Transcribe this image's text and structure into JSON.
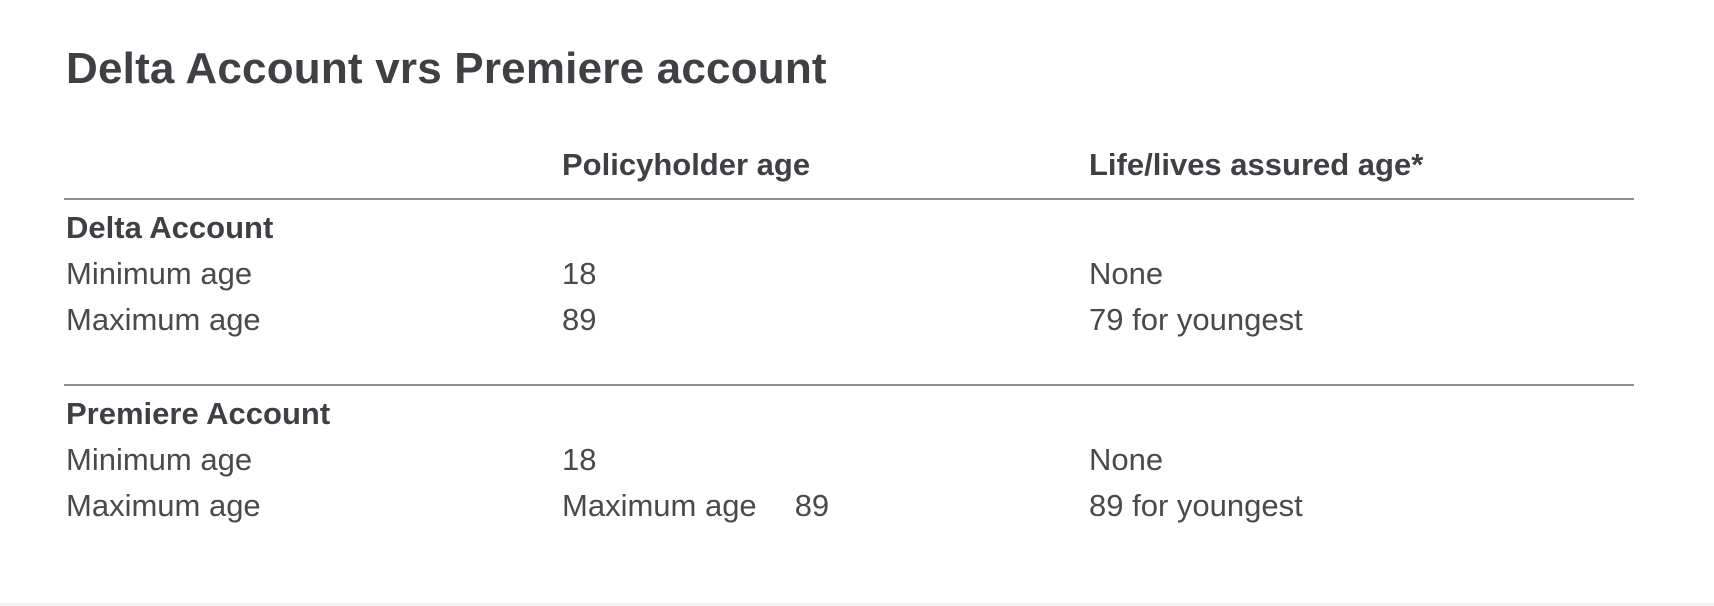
{
  "title": "Delta Account vrs Premiere account",
  "columns": {
    "policyholder": "Policyholder age",
    "life_assured": "Life/lives assured age*"
  },
  "sections": [
    {
      "name": "Delta Account",
      "rows": [
        {
          "label": "Minimum age",
          "policyholder": "18",
          "life_assured": "None"
        },
        {
          "label": "Maximum age",
          "policyholder": "89",
          "life_assured": "79 for youngest"
        }
      ]
    },
    {
      "name": "Premiere Account",
      "rows": [
        {
          "label": "Minimum age",
          "policyholder": "18",
          "life_assured": "None"
        },
        {
          "label": "Maximum age",
          "policyholder_label": "Maximum age",
          "policyholder": "89",
          "life_assured": "89 for youngest"
        }
      ]
    }
  ]
}
